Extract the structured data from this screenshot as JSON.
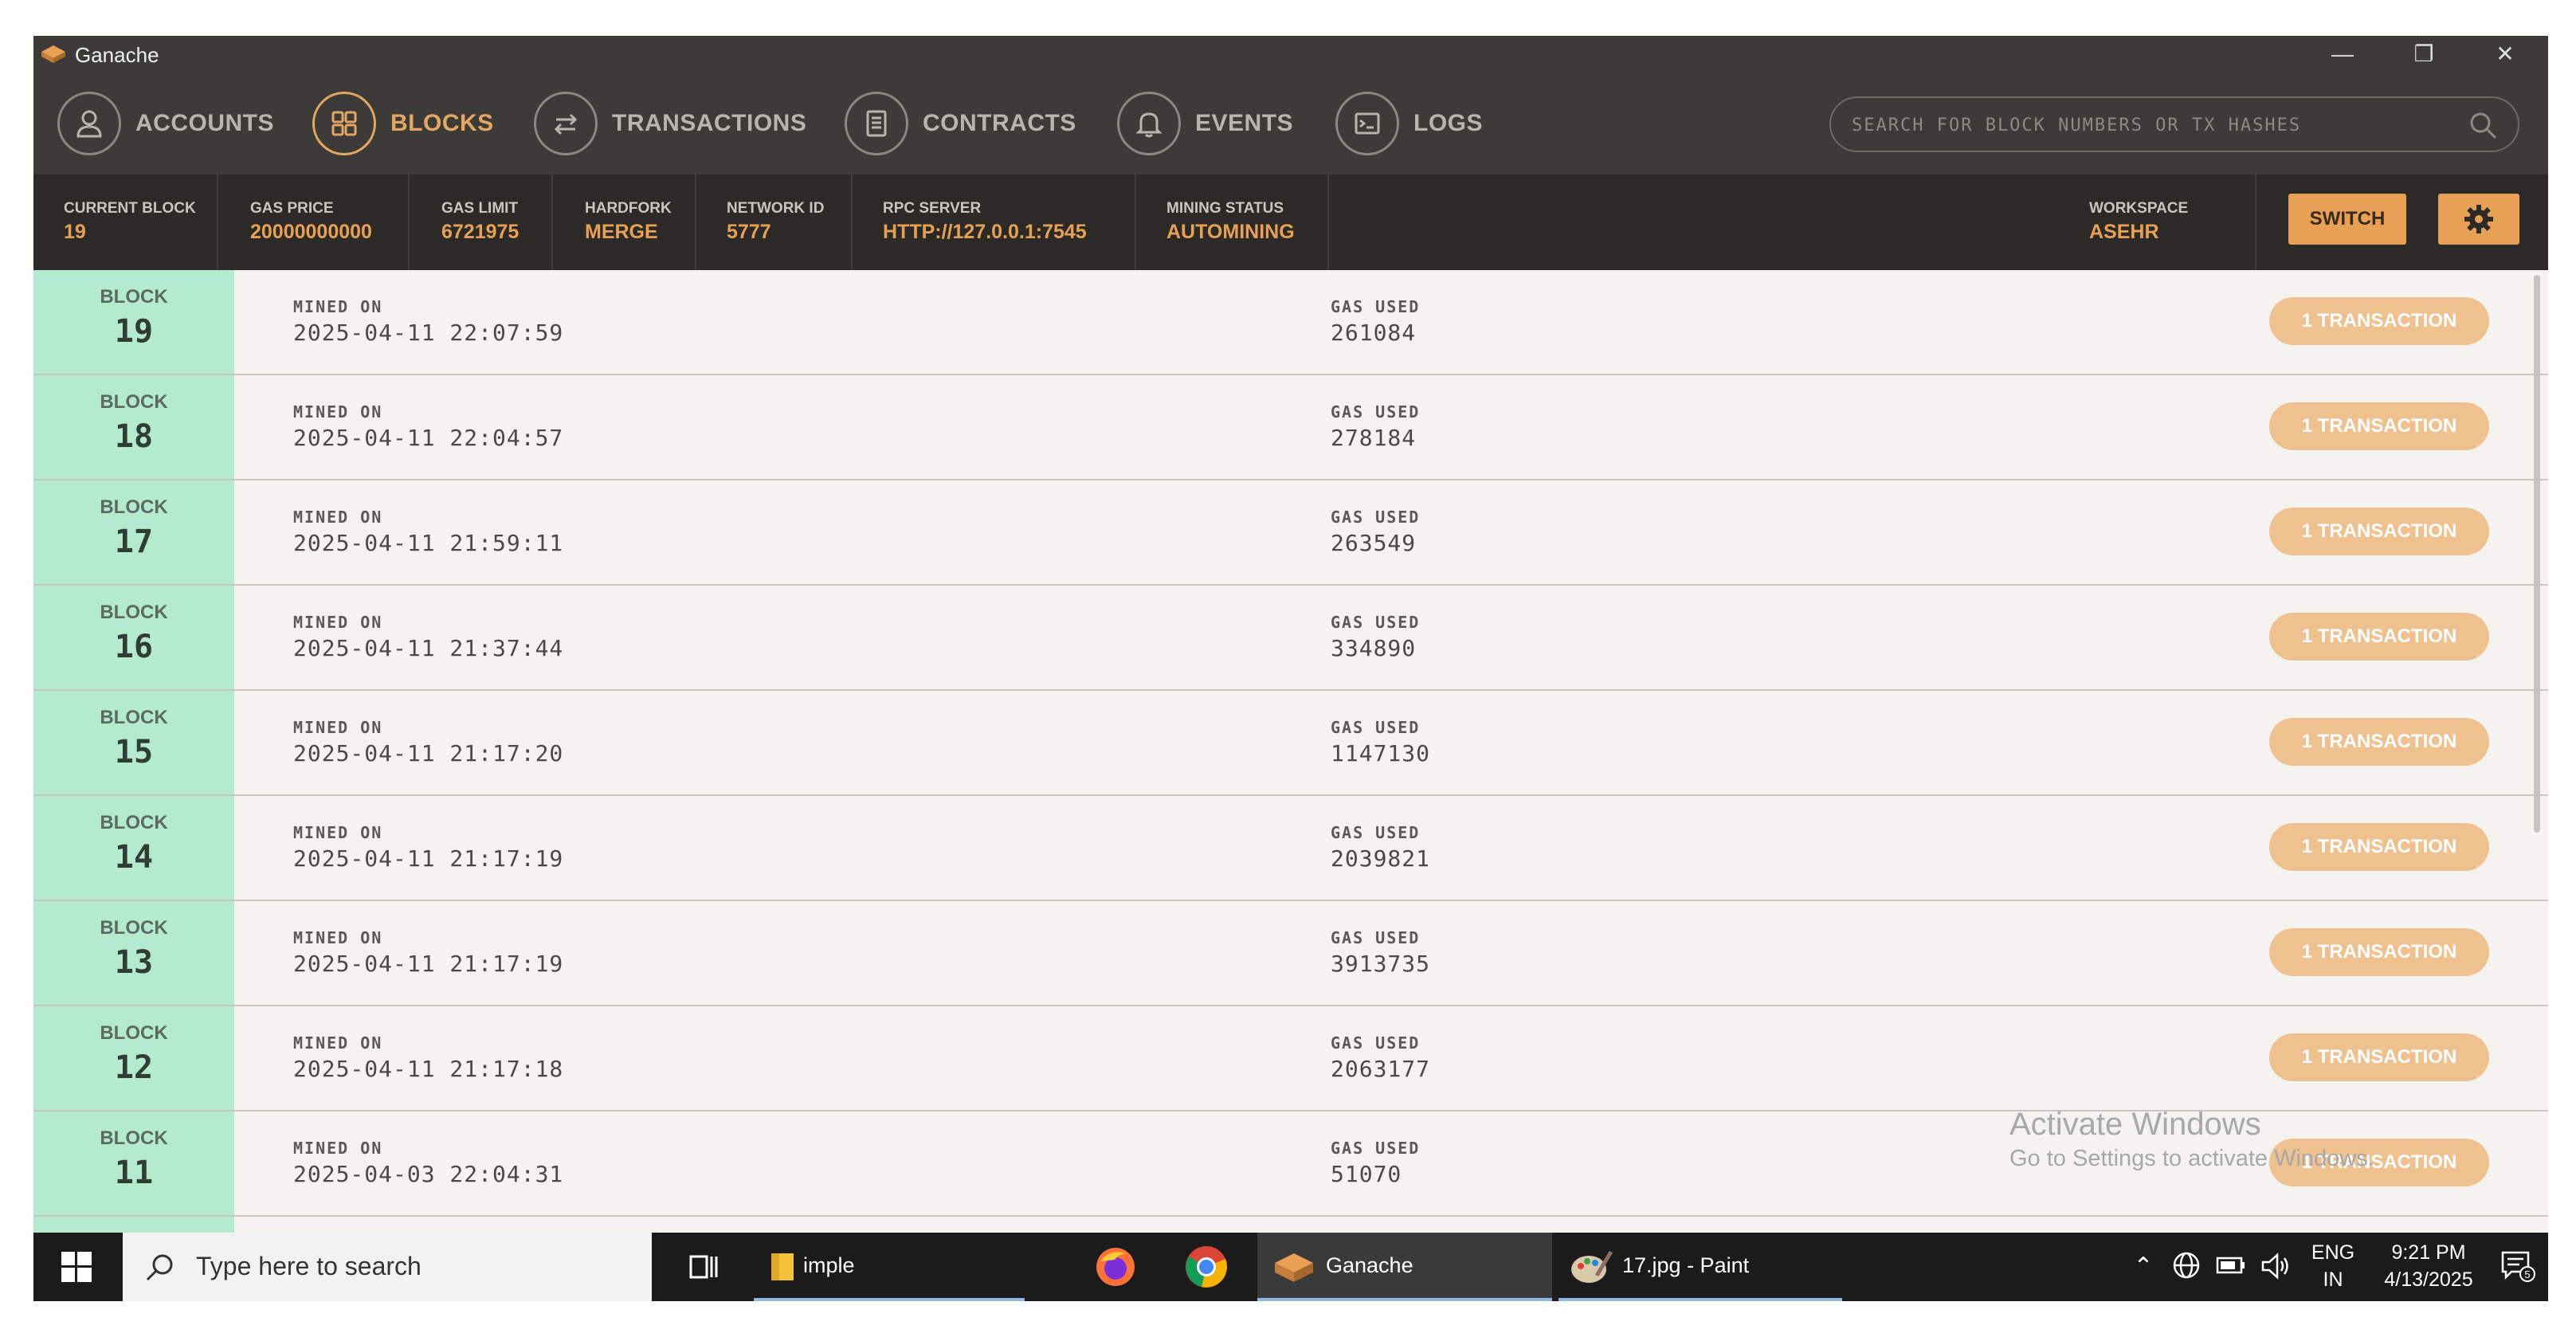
{
  "window": {
    "title": "Ganache"
  },
  "nav": {
    "items": [
      {
        "label": "ACCOUNTS",
        "icon": "account-icon",
        "active": false
      },
      {
        "label": "BLOCKS",
        "icon": "blocks-icon",
        "active": true
      },
      {
        "label": "TRANSACTIONS",
        "icon": "transactions-icon",
        "active": false
      },
      {
        "label": "CONTRACTS",
        "icon": "contracts-icon",
        "active": false
      },
      {
        "label": "EVENTS",
        "icon": "bell-icon",
        "active": false
      },
      {
        "label": "LOGS",
        "icon": "terminal-icon",
        "active": false
      }
    ],
    "search_placeholder": "SEARCH FOR BLOCK NUMBERS OR TX HASHES"
  },
  "status": {
    "current_block": {
      "label": "CURRENT BLOCK",
      "value": "19"
    },
    "gas_price": {
      "label": "GAS PRICE",
      "value": "20000000000"
    },
    "gas_limit": {
      "label": "GAS LIMIT",
      "value": "6721975"
    },
    "hardfork": {
      "label": "HARDFORK",
      "value": "MERGE"
    },
    "network_id": {
      "label": "NETWORK ID",
      "value": "5777"
    },
    "rpc_server": {
      "label": "RPC SERVER",
      "value": "HTTP://127.0.0.1:7545"
    },
    "mining_status": {
      "label": "MINING STATUS",
      "value": "AUTOMINING"
    },
    "workspace": {
      "label": "WORKSPACE",
      "value": "ASEHR"
    },
    "switch_label": "SWITCH"
  },
  "blocks": {
    "block_label": "BLOCK",
    "mined_label": "MINED ON",
    "gas_label": "GAS USED",
    "rows": [
      {
        "number": "19",
        "mined_on": "2025-04-11 22:07:59",
        "gas_used": "261084",
        "tx": "1 TRANSACTION"
      },
      {
        "number": "18",
        "mined_on": "2025-04-11 22:04:57",
        "gas_used": "278184",
        "tx": "1 TRANSACTION"
      },
      {
        "number": "17",
        "mined_on": "2025-04-11 21:59:11",
        "gas_used": "263549",
        "tx": "1 TRANSACTION"
      },
      {
        "number": "16",
        "mined_on": "2025-04-11 21:37:44",
        "gas_used": "334890",
        "tx": "1 TRANSACTION"
      },
      {
        "number": "15",
        "mined_on": "2025-04-11 21:17:20",
        "gas_used": "1147130",
        "tx": "1 TRANSACTION"
      },
      {
        "number": "14",
        "mined_on": "2025-04-11 21:17:19",
        "gas_used": "2039821",
        "tx": "1 TRANSACTION"
      },
      {
        "number": "13",
        "mined_on": "2025-04-11 21:17:19",
        "gas_used": "3913735",
        "tx": "1 TRANSACTION"
      },
      {
        "number": "12",
        "mined_on": "2025-04-11 21:17:18",
        "gas_used": "2063177",
        "tx": "1 TRANSACTION"
      },
      {
        "number": "11",
        "mined_on": "2025-04-03 22:04:31",
        "gas_used": "51070",
        "tx": "1 TRANSACTION"
      }
    ]
  },
  "watermark": {
    "line1": "Activate Windows",
    "line2": "Go to Settings to activate Windows."
  },
  "taskbar": {
    "search_placeholder": "Type here to search",
    "apps": [
      {
        "label": "imple",
        "icon": "folder-icon"
      },
      {
        "label": "",
        "icon": "firefox-icon"
      },
      {
        "label": "",
        "icon": "chrome-icon"
      },
      {
        "label": "Ganache",
        "icon": "ganache-icon"
      },
      {
        "label": "17.jpg - Paint",
        "icon": "paint-icon"
      }
    ],
    "lang": "ENG",
    "region": "IN",
    "time": "9:21 PM",
    "date": "4/13/2025",
    "notification_count": "5"
  },
  "colors": {
    "accent": "#e8a055",
    "block_bg": "#b4ebcf",
    "chrome": "#3c3b37"
  }
}
